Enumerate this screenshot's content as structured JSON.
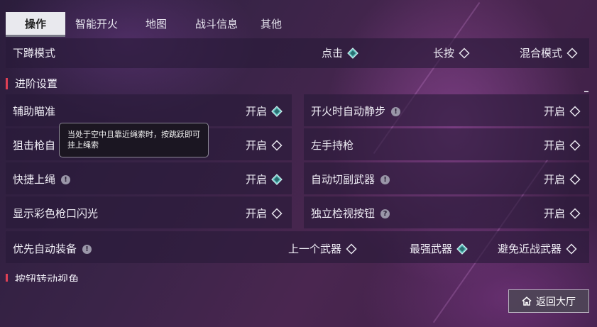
{
  "tabs": [
    {
      "label": "操作",
      "active": true
    },
    {
      "label": "智能开火",
      "active": false
    },
    {
      "label": "地图",
      "active": false
    },
    {
      "label": "战斗信息",
      "active": false
    },
    {
      "label": "其他",
      "active": false
    }
  ],
  "crouch": {
    "label": "下蹲模式",
    "options": [
      {
        "label": "点击",
        "selected": true
      },
      {
        "label": "长按",
        "selected": false
      },
      {
        "label": "混合模式",
        "selected": false
      }
    ]
  },
  "sections": {
    "advanced": "进阶设置",
    "next": "按钮转动视角"
  },
  "settings": {
    "aim_assist": {
      "label": "辅助瞄准",
      "option": "开启",
      "selected": true
    },
    "auto_silent_step": {
      "label": "开火时自动静步",
      "option": "开启",
      "selected": false
    },
    "sniper": {
      "label": "狙击枪自",
      "option": "开启",
      "selected": false
    },
    "left_hand": {
      "label": "左手持枪",
      "option": "开启",
      "selected": false
    },
    "quick_rope": {
      "label": "快捷上绳",
      "option": "开启",
      "selected": true
    },
    "auto_switch": {
      "label": "自动切副武器",
      "option": "开启",
      "selected": false
    },
    "muzzle_flash": {
      "label": "显示彩色枪口闪光",
      "option": "开启",
      "selected": false
    },
    "inspect_button": {
      "label": "独立检视按钮",
      "option": "开启",
      "selected": false
    }
  },
  "auto_equip": {
    "label": "优先自动装备",
    "options": [
      {
        "label": "上一个武器",
        "selected": false
      },
      {
        "label": "最强武器",
        "selected": true
      },
      {
        "label": "避免近战武器",
        "selected": false
      }
    ]
  },
  "tooltip": {
    "line1": "当处于空中且靠近绳索时，按跳跃即可",
    "line2": "挂上绳索"
  },
  "back_button": "返回大厅",
  "colors": {
    "selected_diamond": "#5fc3c0",
    "section_bar": "#e04055"
  }
}
